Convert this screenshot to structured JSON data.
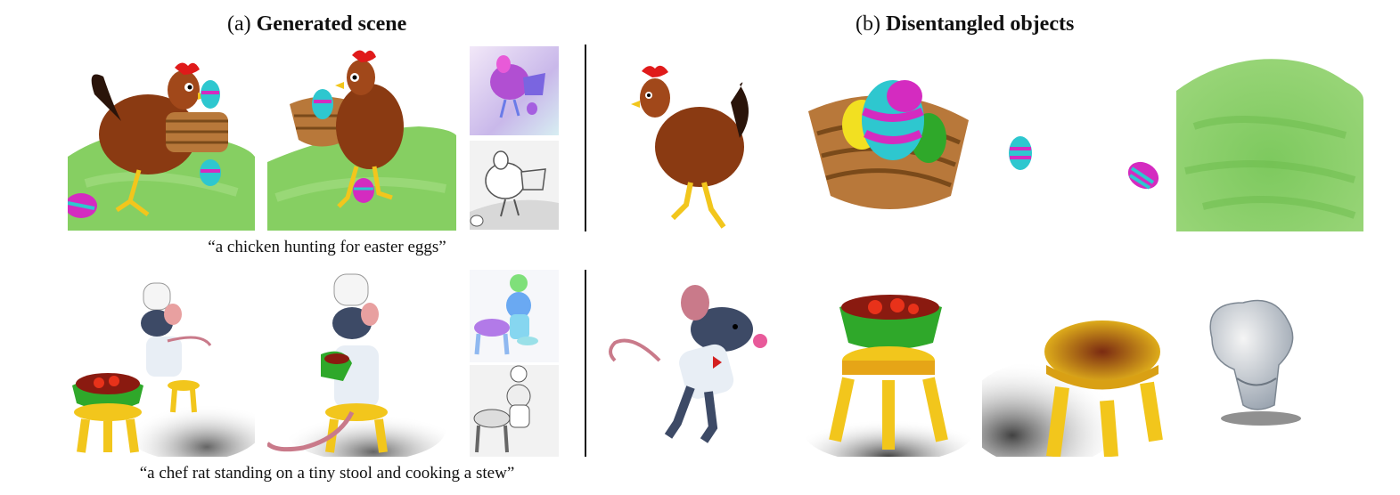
{
  "titles": {
    "left_prefix": "(a)",
    "left_bold": "Generated scene",
    "right_prefix": "(b)",
    "right_bold": "Disentangled objects"
  },
  "captions": {
    "row1": "“a chicken hunting for easter eggs”",
    "row2": "“a chef rat standing on a tiny stool and cooking a stew”"
  },
  "colors": {
    "grass": "#7cc85a",
    "chicken_body": "#8a3a12",
    "comb": "#e01a1a",
    "egg_cyan": "#2ec7cf",
    "egg_magenta": "#d42bc0",
    "basket": "#b8783a",
    "rat": "#3d4a66",
    "stool": "#f2c61c",
    "bowl_green": "#2fa82a"
  }
}
